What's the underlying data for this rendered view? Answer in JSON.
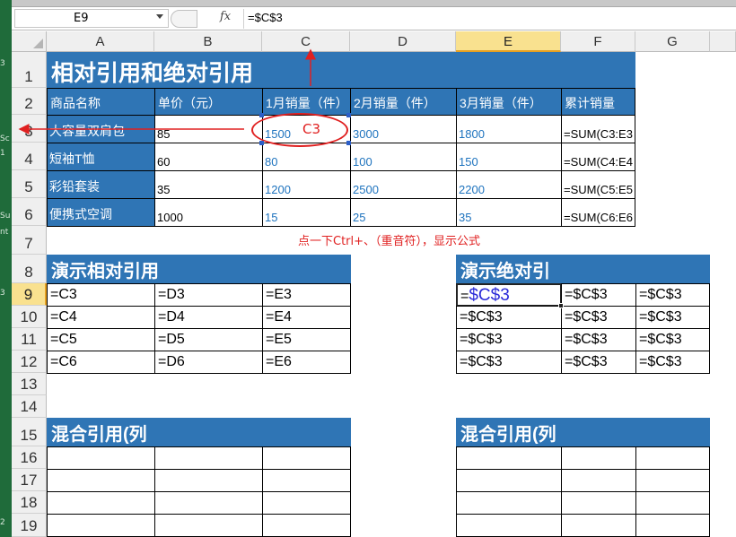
{
  "window": {
    "name_box": "E9",
    "formula": "=$C$3",
    "fx_label": "fx"
  },
  "left_strip_text": [
    "3",
    "Sc",
    "1",
    "Su",
    "nt",
    "3",
    "2"
  ],
  "columns": [
    "A",
    "B",
    "C",
    "D",
    "E",
    "F",
    "G"
  ],
  "selected_column": "E",
  "rows": [
    "1",
    "2",
    "3",
    "4",
    "5",
    "6",
    "7",
    "8",
    "9",
    "10",
    "11",
    "12",
    "13",
    "14",
    "15",
    "16",
    "17",
    "18",
    "19"
  ],
  "selected_row": "9",
  "main_table": {
    "title": "相对引用和绝对引用",
    "headers": [
      "商品名称",
      "单价（元）",
      "1月销量（件）",
      "2月销量（件）",
      "3月销量（件）",
      "累计销量"
    ],
    "rows": [
      {
        "name": "大容量双肩包",
        "price": "85",
        "m1": "1500",
        "m2": "3000",
        "m3": "1800",
        "total": "=SUM(C3:E3"
      },
      {
        "name": "短袖T恤",
        "price": "60",
        "m1": "80",
        "m2": "100",
        "m3": "150",
        "total": "=SUM(C4:E4"
      },
      {
        "name": "彩铅套装",
        "price": "35",
        "m1": "1200",
        "m2": "2500",
        "m3": "2200",
        "total": "=SUM(C5:E5"
      },
      {
        "name": "便携式空调",
        "price": "1000",
        "m1": "15",
        "m2": "25",
        "m3": "35",
        "total": "=SUM(C6:E6"
      }
    ]
  },
  "annotation": {
    "circle_label": "C3",
    "note": "点一下Ctrl+、（重音符），显示公式"
  },
  "relative_section": {
    "title": "演示相对引用",
    "rows": [
      [
        "=C3",
        "=D3",
        "=E3"
      ],
      [
        "=C4",
        "=D4",
        "=E4"
      ],
      [
        "=C5",
        "=D5",
        "=E5"
      ],
      [
        "=C6",
        "=D6",
        "=E6"
      ]
    ]
  },
  "absolute_section": {
    "title": "演示绝对引",
    "active_prefix": "=",
    "active_value": "$C$3",
    "rows": [
      [
        "=$C$3",
        "=$C$3",
        "=$C$3"
      ],
      [
        "=$C$3",
        "=$C$3",
        "=$C$3"
      ],
      [
        "=$C$3",
        "=$C$3",
        "=$C$3"
      ],
      [
        "=$C$3",
        "=$C$3",
        "=$C$3"
      ]
    ]
  },
  "mixed_left": {
    "title": "混合引用(列"
  },
  "mixed_right": {
    "title": "混合引用(列"
  },
  "colors": {
    "header_blue": "#2f75b5",
    "annotation_red": "#e02020",
    "value_blue": "#1e73be",
    "selection_yellow": "#f9e18f"
  }
}
